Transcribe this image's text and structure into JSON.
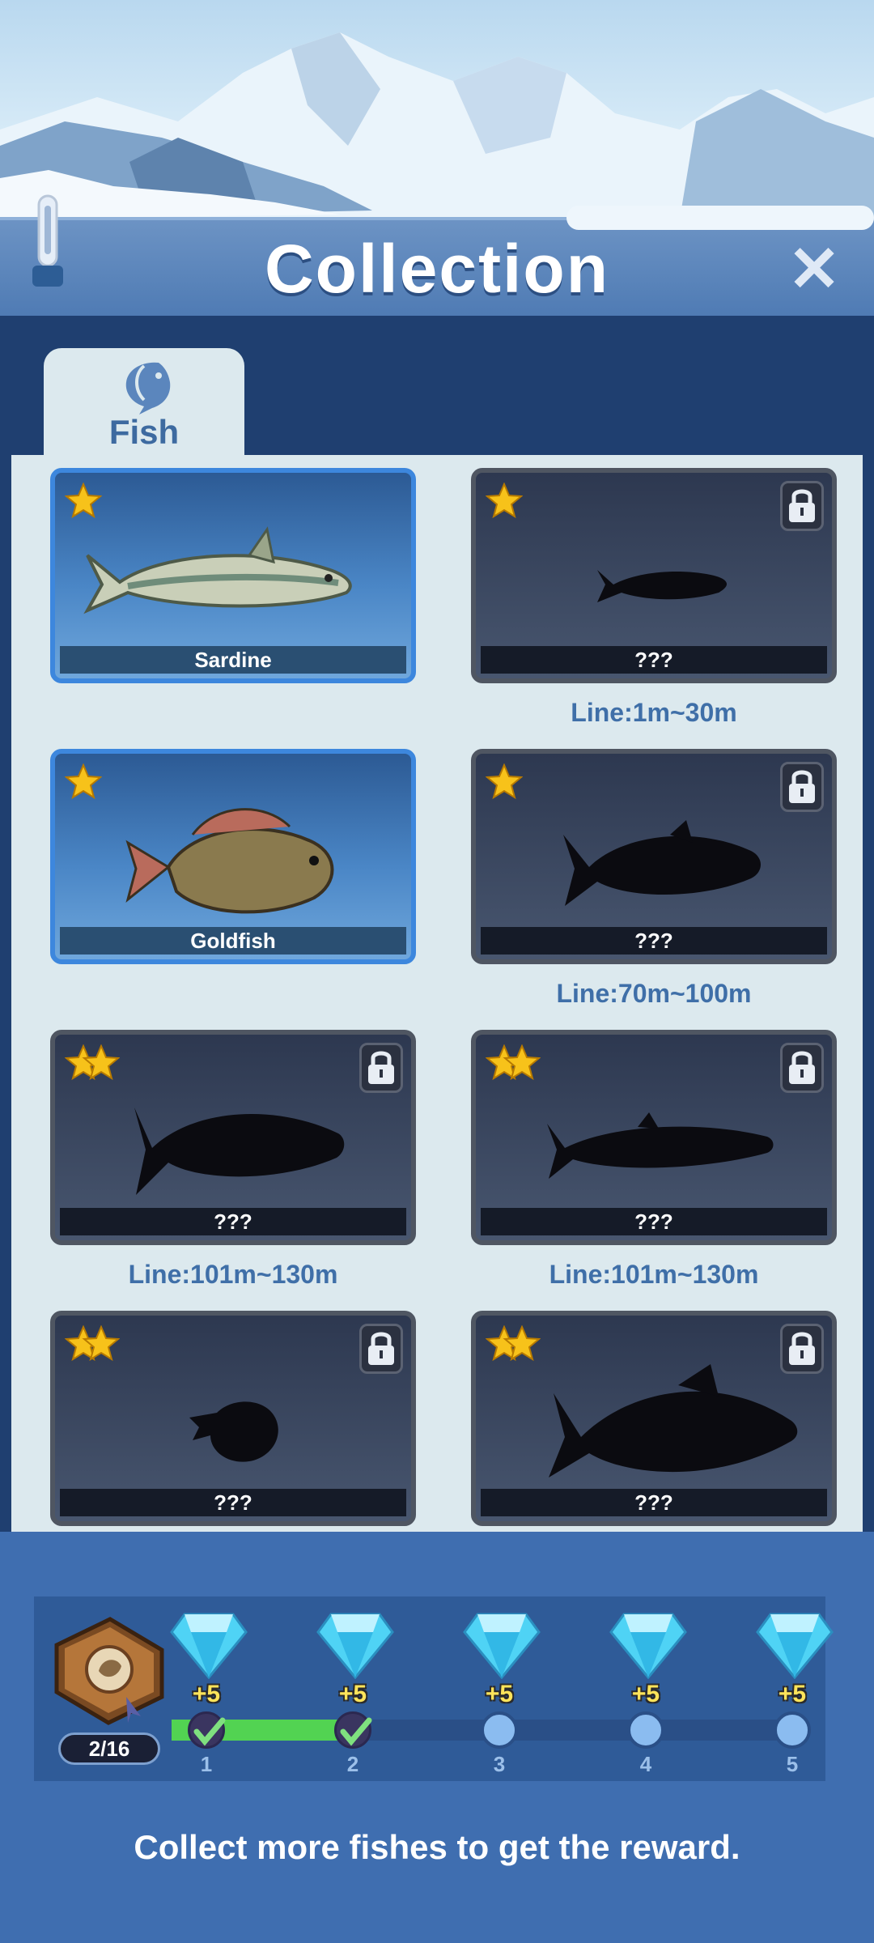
{
  "header": {
    "title": "Collection",
    "close_glyph": "✕"
  },
  "tabs": [
    {
      "label": "Fish",
      "icon": "fish-icon",
      "active": true
    }
  ],
  "cards": [
    {
      "name": "Sardine",
      "stars": 1,
      "locked": false,
      "line": ""
    },
    {
      "name": "???",
      "stars": 1,
      "locked": true,
      "line": "Line:1m~30m"
    },
    {
      "name": "Goldfish",
      "stars": 1,
      "locked": false,
      "line": ""
    },
    {
      "name": "???",
      "stars": 1,
      "locked": true,
      "line": "Line:70m~100m"
    },
    {
      "name": "???",
      "stars": 2,
      "locked": true,
      "line": "Line:101m~130m"
    },
    {
      "name": "???",
      "stars": 2,
      "locked": true,
      "line": "Line:101m~130m"
    },
    {
      "name": "???",
      "stars": 2,
      "locked": true,
      "line": ""
    },
    {
      "name": "???",
      "stars": 2,
      "locked": true,
      "line": ""
    }
  ],
  "rewards": {
    "progress": "2/16",
    "items": [
      {
        "amount": "+5",
        "index": "1",
        "claimed": true
      },
      {
        "amount": "+5",
        "index": "2",
        "claimed": true
      },
      {
        "amount": "+5",
        "index": "3",
        "claimed": false
      },
      {
        "amount": "+5",
        "index": "4",
        "claimed": false
      },
      {
        "amount": "+5",
        "index": "5",
        "claimed": false
      }
    ]
  },
  "hint": "Collect more fishes to get the reward.",
  "colors": {
    "accent": "#3d87dd",
    "progress_fill": "#52d352",
    "star": "#f7c21a",
    "reward_text": "#ffe45a"
  }
}
